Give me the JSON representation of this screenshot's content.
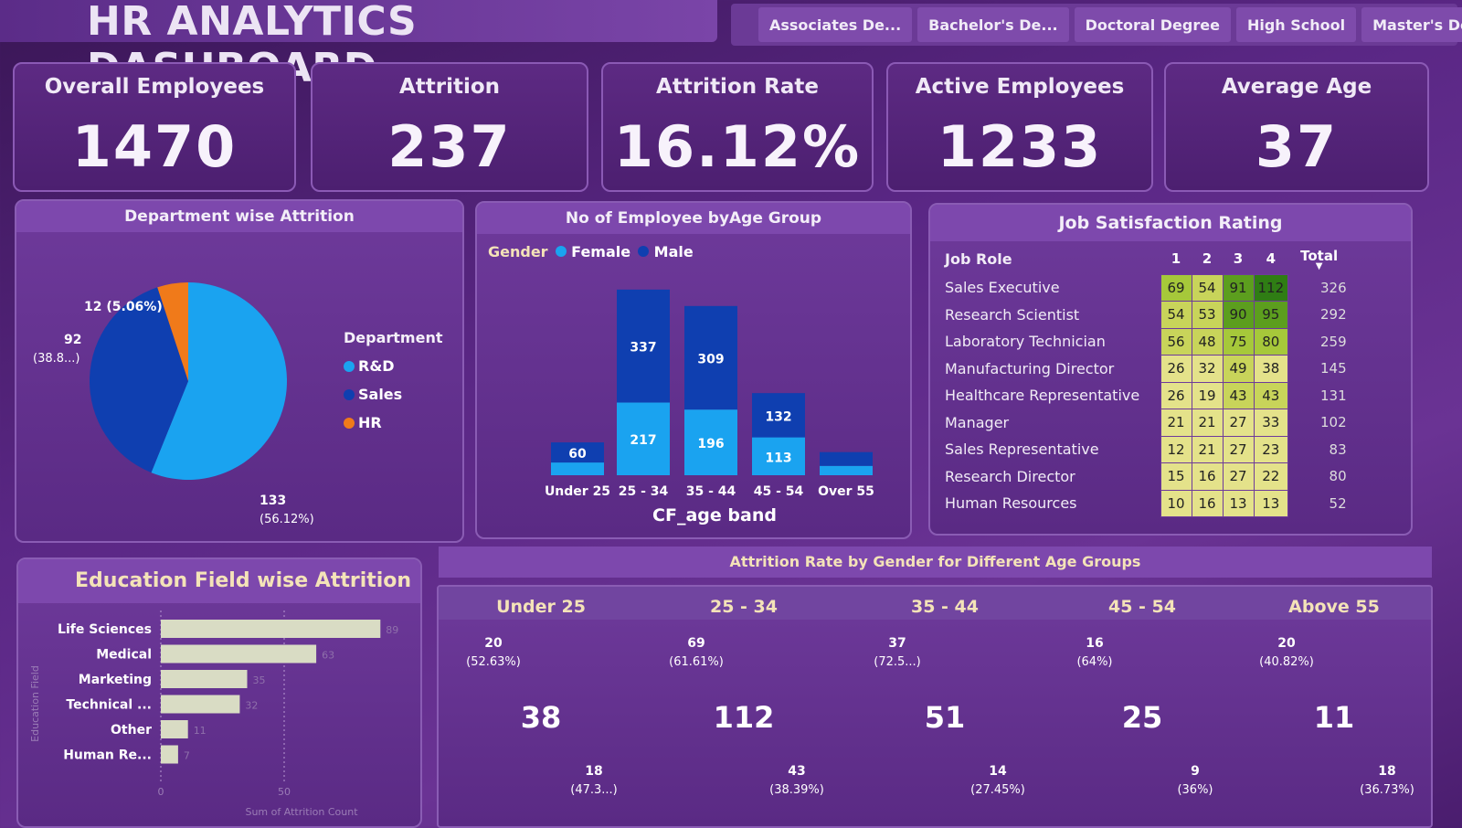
{
  "title": "HR ANALYTICS DASHBOARD",
  "slicer": [
    "Associates De...",
    "Bachelor's De...",
    "Doctoral Degree",
    "High School",
    "Master's Degree"
  ],
  "kpis": [
    {
      "label": "Overall Employees",
      "value": "1470"
    },
    {
      "label": "Attrition",
      "value": "237"
    },
    {
      "label": "Attrition Rate",
      "value": "16.12%"
    },
    {
      "label": "Active Employees",
      "value": "1233"
    },
    {
      "label": "Average Age",
      "value": "37"
    }
  ],
  "colors": {
    "light_blue": "#1aa3f0",
    "dark_blue": "#0f3fb0",
    "orange": "#f07a1a",
    "bar_light": "#d9dcc4"
  },
  "chart_data": [
    {
      "type": "pie",
      "title": "Department wise Attrition",
      "legend_title": "Department",
      "legend_placement": "right",
      "slices": [
        {
          "name": "R&D",
          "value": 133,
          "label": "133",
          "pct_label": "(56.12%)",
          "color": "#1aa3f0"
        },
        {
          "name": "Sales",
          "value": 92,
          "label": "92",
          "pct_label": "(38.8...)",
          "color": "#0f3fb0"
        },
        {
          "name": "HR",
          "value": 12,
          "label": "12 (5.06%)",
          "pct_label": "",
          "color": "#f07a1a"
        }
      ]
    },
    {
      "type": "bar",
      "stacked": true,
      "title": "No of Employee byAge Group",
      "legend_title": "Gender",
      "xlabel": "CF_age band",
      "categories": [
        "Under 25",
        "25 - 34",
        "35 - 44",
        "45 - 54",
        "Over 55"
      ],
      "series": [
        {
          "name": "Female",
          "values": [
            38,
            217,
            196,
            113,
            28
          ],
          "labels": [
            "",
            "217",
            "196",
            "113",
            ""
          ],
          "color": "#1aa3f0"
        },
        {
          "name": "Male",
          "values": [
            60,
            337,
            309,
            132,
            41
          ],
          "labels": [
            "60",
            "337",
            "309",
            "132",
            ""
          ],
          "color": "#0f3fb0"
        }
      ],
      "ylim": [
        0,
        600
      ]
    },
    {
      "type": "table",
      "title": "Job Satisfaction Rating",
      "columns": [
        "Job Role",
        "1",
        "2",
        "3",
        "4",
        "Total"
      ],
      "rows": [
        [
          "Sales Executive",
          69,
          54,
          91,
          112,
          326
        ],
        [
          "Research Scientist",
          54,
          53,
          90,
          95,
          292
        ],
        [
          "Laboratory Technician",
          56,
          48,
          75,
          80,
          259
        ],
        [
          "Manufacturing Director",
          26,
          32,
          49,
          38,
          145
        ],
        [
          "Healthcare Representative",
          26,
          19,
          43,
          43,
          131
        ],
        [
          "Manager",
          21,
          21,
          27,
          33,
          102
        ],
        [
          "Sales Representative",
          12,
          21,
          27,
          23,
          83
        ],
        [
          "Research Director",
          15,
          16,
          27,
          22,
          80
        ],
        [
          "Human Resources",
          10,
          16,
          13,
          13,
          52
        ]
      ]
    },
    {
      "type": "bar",
      "orientation": "horizontal",
      "title": "Education Field wise Attrition",
      "xlabel": "Sum of Attrition Count",
      "ylabel": "Education Field",
      "categories": [
        "Life Sciences",
        "Medical",
        "Marketing",
        "Technical ...",
        "Other",
        "Human Re..."
      ],
      "values": [
        89,
        63,
        35,
        32,
        11,
        7
      ],
      "xlim": [
        0,
        100
      ],
      "ticks": [
        "0",
        "50"
      ]
    },
    {
      "type": "pie",
      "title": "Attrition Rate by Gender for Different Age Groups",
      "donuts": [
        {
          "group": "Under 25",
          "total": "38",
          "male": 20,
          "male_label": "20",
          "male_pct": "(52.63%)",
          "female": 18,
          "female_label": "18",
          "female_pct": "(47.3...)"
        },
        {
          "group": "25 - 34",
          "total": "112",
          "male": 69,
          "male_label": "69",
          "male_pct": "(61.61%)",
          "female": 43,
          "female_label": "43",
          "female_pct": "(38.39%)"
        },
        {
          "group": "35 - 44",
          "total": "51",
          "male": 37,
          "male_label": "37",
          "male_pct": "(72.5...)",
          "female": 14,
          "female_label": "14",
          "female_pct": "(27.45%)"
        },
        {
          "group": "45 - 54",
          "total": "25",
          "male": 16,
          "male_label": "16",
          "male_pct": "(64%)",
          "female": 9,
          "female_label": "9",
          "female_pct": "(36%)"
        },
        {
          "group": "Above 55",
          "total": "11",
          "male": 20,
          "male_label": "20",
          "male_pct": "(40.82%)",
          "female": 18,
          "female_label": "18",
          "female_pct": "(36.73%)"
        }
      ]
    }
  ]
}
